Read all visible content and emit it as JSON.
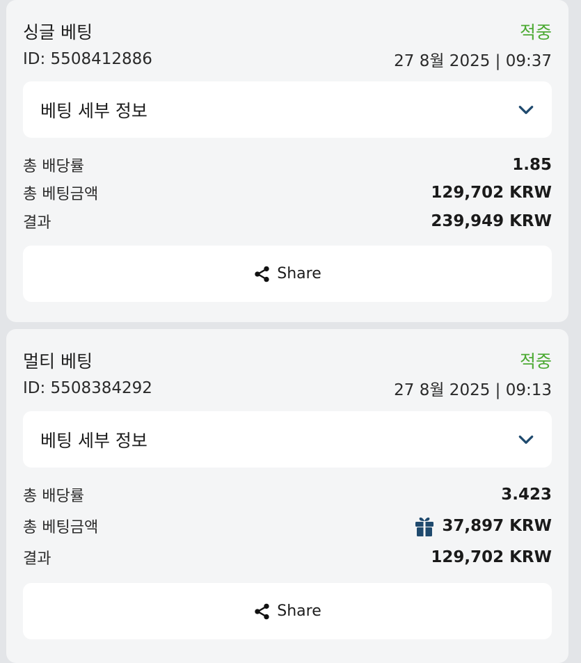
{
  "bets": [
    {
      "title": "싱글 베팅",
      "status": "적중",
      "id_label": "ID: 5508412886",
      "datetime": "27 8월 2025 | 09:37",
      "details_label": "베팅 세부 정보",
      "rows": [
        {
          "label": "총 배당률",
          "value": "1.85"
        },
        {
          "label": "총 베팅금액",
          "value": "129,702 KRW"
        },
        {
          "label": "결과",
          "value": "239,949 KRW"
        }
      ],
      "share_label": "Share"
    },
    {
      "title": "멀티 베팅",
      "status": "적중",
      "id_label": "ID: 5508384292",
      "datetime": "27 8월 2025 | 09:13",
      "details_label": "베팅 세부 정보",
      "rows": [
        {
          "label": "총 배당률",
          "value": "3.423"
        },
        {
          "label": "총 베팅금액",
          "value": "37,897 KRW",
          "icon": "gift-icon"
        },
        {
          "label": "결과",
          "value": "129,702 KRW"
        }
      ],
      "share_label": "Share"
    }
  ],
  "colors": {
    "status_green": "#4caa33",
    "chevron": "#1f4a6e",
    "gift": "#1f4a6e",
    "card_bg": "#f4f5f6",
    "page_bg": "#e3e5e8"
  }
}
